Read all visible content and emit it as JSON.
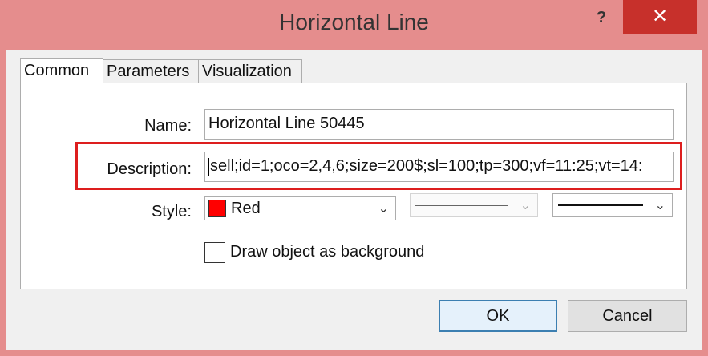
{
  "window": {
    "title": "Horizontal Line",
    "help_label": "?",
    "close_label": "✕"
  },
  "tabs": [
    {
      "label": "Common",
      "active": true
    },
    {
      "label": "Parameters",
      "active": false
    },
    {
      "label": "Visualization",
      "active": false
    }
  ],
  "fields": {
    "name_label": "Name:",
    "name_value": "Horizontal Line 50445",
    "description_label": "Description:",
    "description_value": "sell;id=1;oco=2,4,6;size=200$;sl=100;tp=300;vf=11:25;vt=14:",
    "style_label": "Style:",
    "color_value": "Red",
    "color_hex": "#ff0000"
  },
  "checkbox": {
    "label": "Draw object as background",
    "checked": false
  },
  "buttons": {
    "ok_label": "OK",
    "cancel_label": "Cancel"
  },
  "colors": {
    "titlebar": "#e58d8d",
    "close_button": "#c7302b",
    "highlight_border": "#dd1e1e"
  }
}
